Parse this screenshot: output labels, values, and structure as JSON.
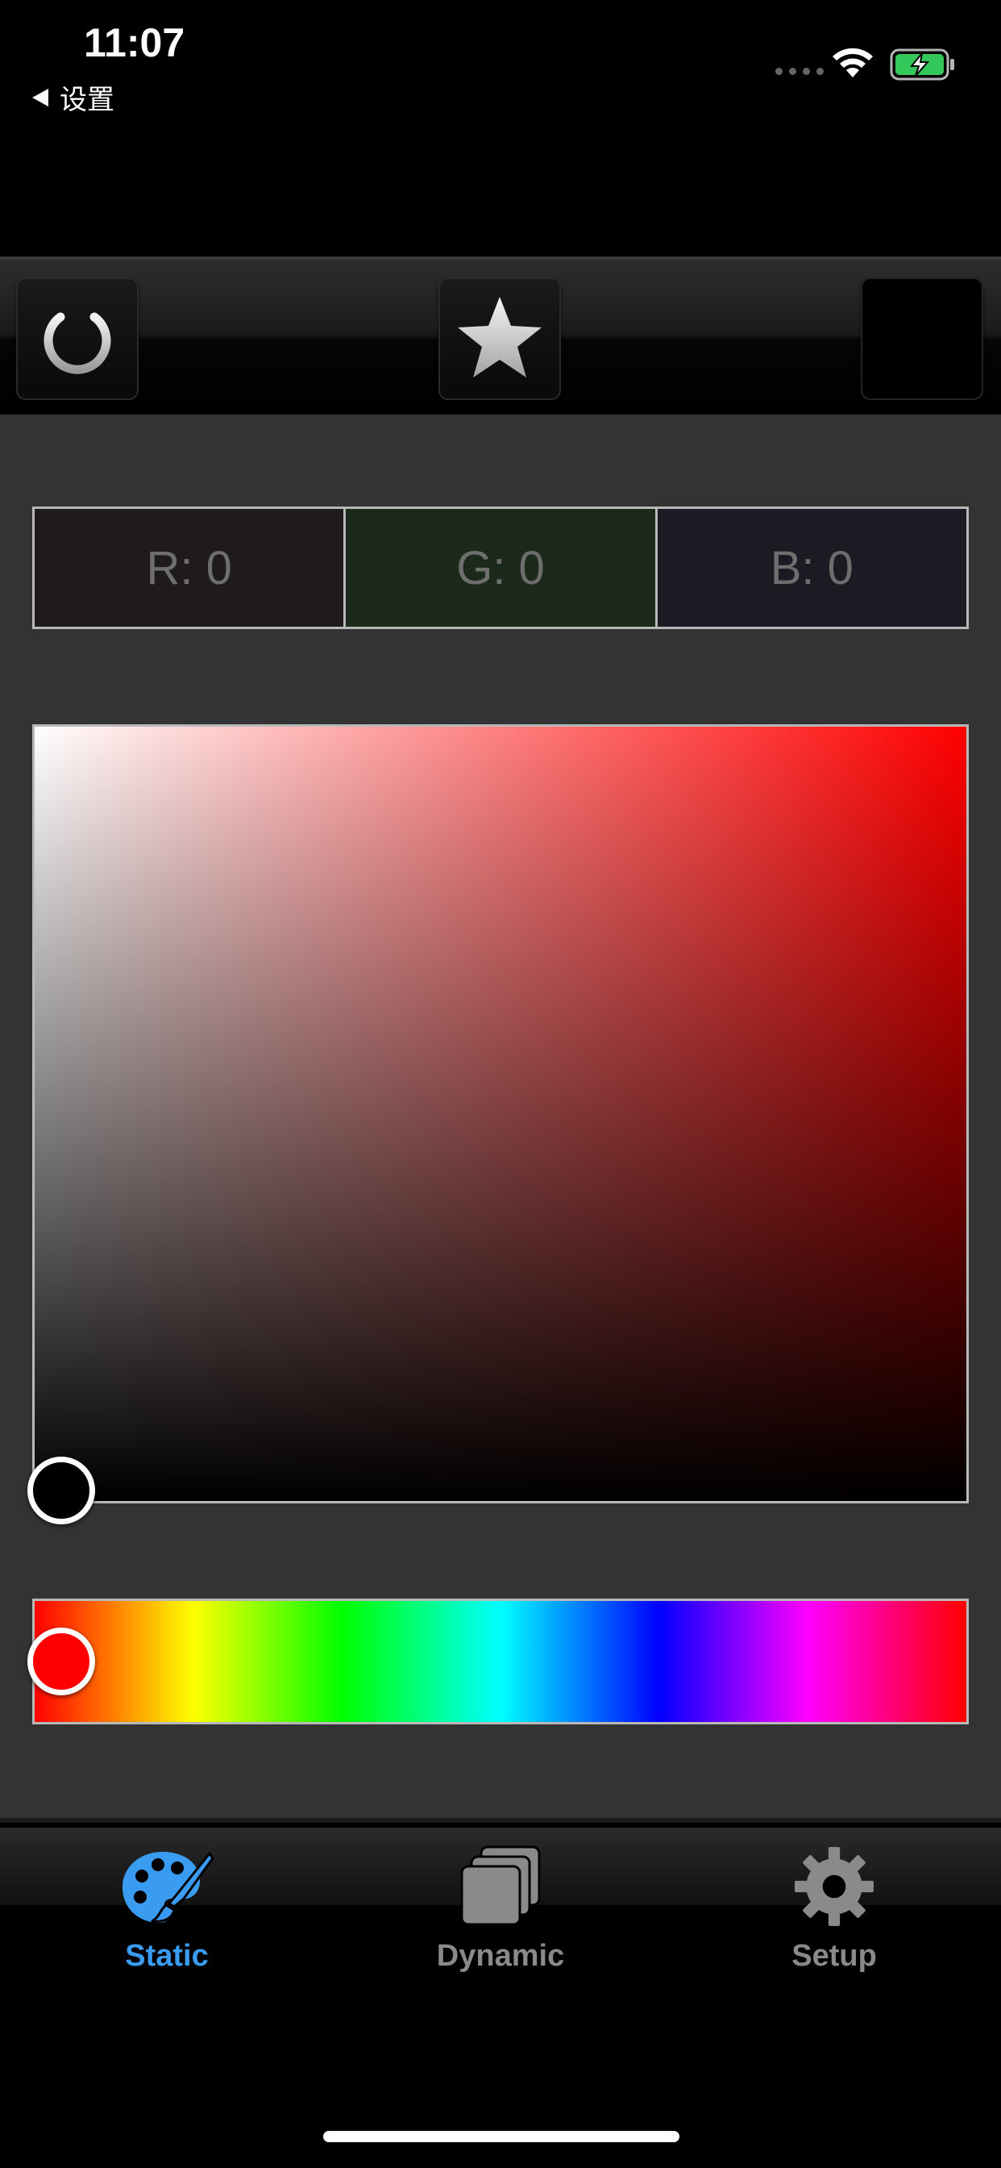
{
  "status_bar": {
    "time": "11:07",
    "back_label": "设置"
  },
  "toolbar": {
    "buttons": [
      "power",
      "favorite",
      "color-swatch"
    ]
  },
  "rgb": {
    "r": "R: 0",
    "g": "G: 0",
    "b": "B: 0"
  },
  "picker": {
    "hue_color": "#ff0000",
    "selected_color": "#000000"
  },
  "tabs": [
    {
      "label": "Static",
      "icon": "palette-icon",
      "active": true
    },
    {
      "label": "Dynamic",
      "icon": "stack-icon",
      "active": false
    },
    {
      "label": "Setup",
      "icon": "gear-icon",
      "active": false
    }
  ],
  "colors": {
    "accent": "#3a9cf0",
    "inactive": "#8a8a8a",
    "panel": "#333333",
    "battery": "#34c759"
  }
}
